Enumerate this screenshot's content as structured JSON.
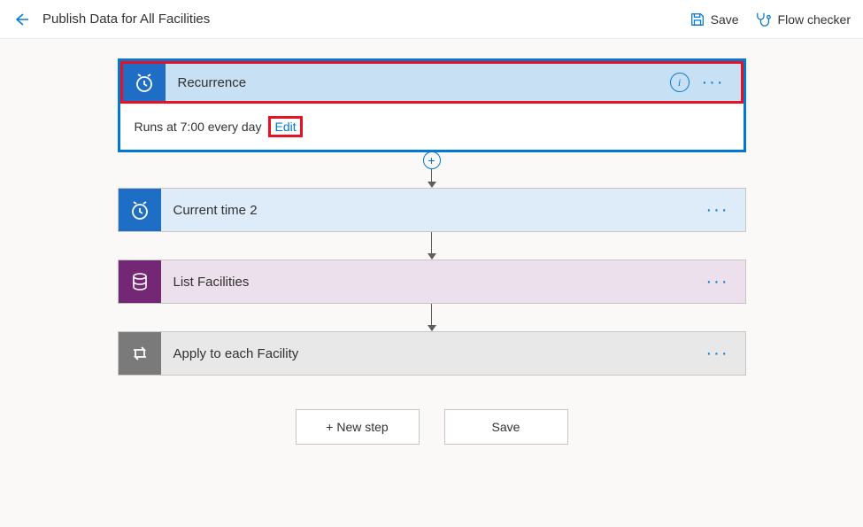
{
  "header": {
    "title": "Publish Data for All Facilities",
    "save_label": "Save",
    "flow_checker_label": "Flow checker"
  },
  "steps": {
    "recurrence": {
      "title": "Recurrence",
      "description": "Runs at 7:00 every day",
      "edit_label": "Edit"
    },
    "current_time": {
      "title": "Current time 2"
    },
    "list_facilities": {
      "title": "List Facilities"
    },
    "apply_each": {
      "title": "Apply to each Facility"
    }
  },
  "footer": {
    "new_step_label": "+ New step",
    "save_label": "Save"
  }
}
